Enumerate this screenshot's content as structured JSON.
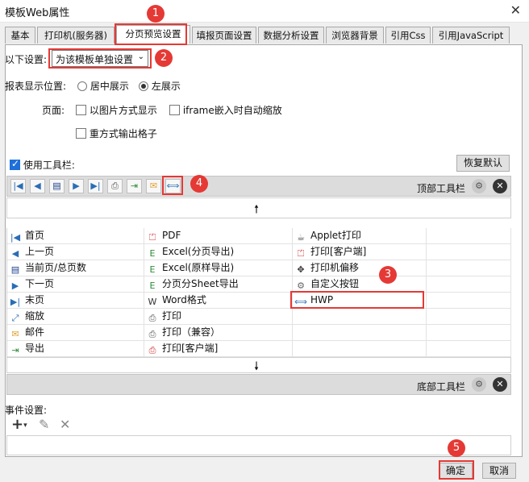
{
  "window": {
    "title": "模板Web属性"
  },
  "tabs": [
    {
      "label": "基本"
    },
    {
      "label": "打印机(服务器)"
    },
    {
      "label": "分页预览设置"
    },
    {
      "label": "填报页面设置"
    },
    {
      "label": "数据分析设置"
    },
    {
      "label": "浏览器背景"
    },
    {
      "label": "引用Css"
    },
    {
      "label": "引用JavaScript"
    }
  ],
  "settings": {
    "mode_label": "以下设置:",
    "mode_value": "为该模板单独设置",
    "position_label": "报表显示位置:",
    "position_options": [
      "居中展示",
      "左展示"
    ],
    "page_label": "页面:",
    "page_options": [
      "以图片方式显示",
      "iframe嵌入时自动缩放",
      "重方式输出格子"
    ]
  },
  "toolbar_section": {
    "use_toolbar_label": "使用工具栏:",
    "restore_default": "恢复默认",
    "top_toolbar_label": "顶部工具栏",
    "bottom_toolbar_label": "底部工具栏"
  },
  "top_toolbar_icons": [
    "first-page-icon",
    "prev-page-icon",
    "current-total-icon",
    "next-page-icon",
    "last-page-icon",
    "print-icon",
    "export-icon",
    "email-icon",
    "hwp-icon"
  ],
  "buttons_grid": {
    "col1": [
      "首页",
      "上一页",
      "当前页/总页数",
      "下一页",
      "末页",
      "缩放",
      "邮件",
      "导出"
    ],
    "col2": [
      "PDF",
      "Excel(分页导出)",
      "Excel(原样导出)",
      "分页分Sheet导出",
      "Word格式",
      "打印",
      "打印（兼容）",
      "打印[客户端]"
    ],
    "col3": [
      "Applet打印",
      "打印[客户端]",
      "打印机偏移",
      "自定义按钮",
      "HWP"
    ]
  },
  "events": {
    "label": "事件设置:"
  },
  "footer": {
    "ok": "确定",
    "cancel": "取消"
  },
  "annotations": [
    "1",
    "2",
    "3",
    "4",
    "5"
  ],
  "colors": {
    "accent_red": "#e53935",
    "selected_blue": "#1e6fd9"
  }
}
